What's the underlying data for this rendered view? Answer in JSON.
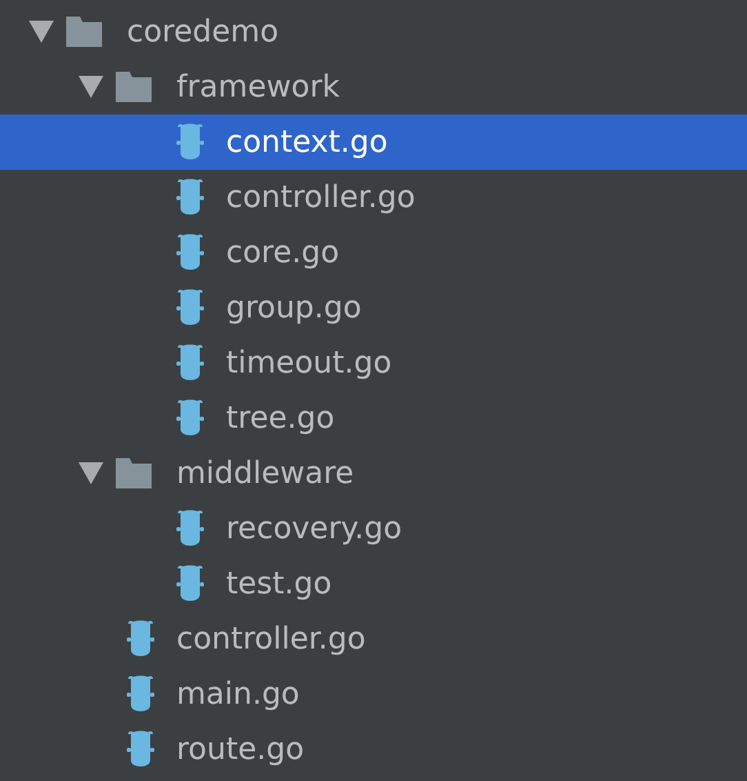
{
  "tree": [
    {
      "kind": "folder",
      "name": "coredemo",
      "expanded": true,
      "selected": false,
      "children": [
        {
          "kind": "folder",
          "name": "framework",
          "expanded": true,
          "selected": false,
          "children": [
            {
              "kind": "file",
              "name": "context.go",
              "selected": true
            },
            {
              "kind": "file",
              "name": "controller.go",
              "selected": false
            },
            {
              "kind": "file",
              "name": "core.go",
              "selected": false
            },
            {
              "kind": "file",
              "name": "group.go",
              "selected": false
            },
            {
              "kind": "file",
              "name": "timeout.go",
              "selected": false
            },
            {
              "kind": "file",
              "name": "tree.go",
              "selected": false
            }
          ]
        },
        {
          "kind": "folder",
          "name": "middleware",
          "expanded": true,
          "selected": false,
          "children": [
            {
              "kind": "file",
              "name": "recovery.go",
              "selected": false
            },
            {
              "kind": "file",
              "name": "test.go",
              "selected": false
            }
          ]
        },
        {
          "kind": "file",
          "name": "controller.go",
          "selected": false
        },
        {
          "kind": "file",
          "name": "main.go",
          "selected": false
        },
        {
          "kind": "file",
          "name": "route.go",
          "selected": false
        }
      ]
    }
  ]
}
